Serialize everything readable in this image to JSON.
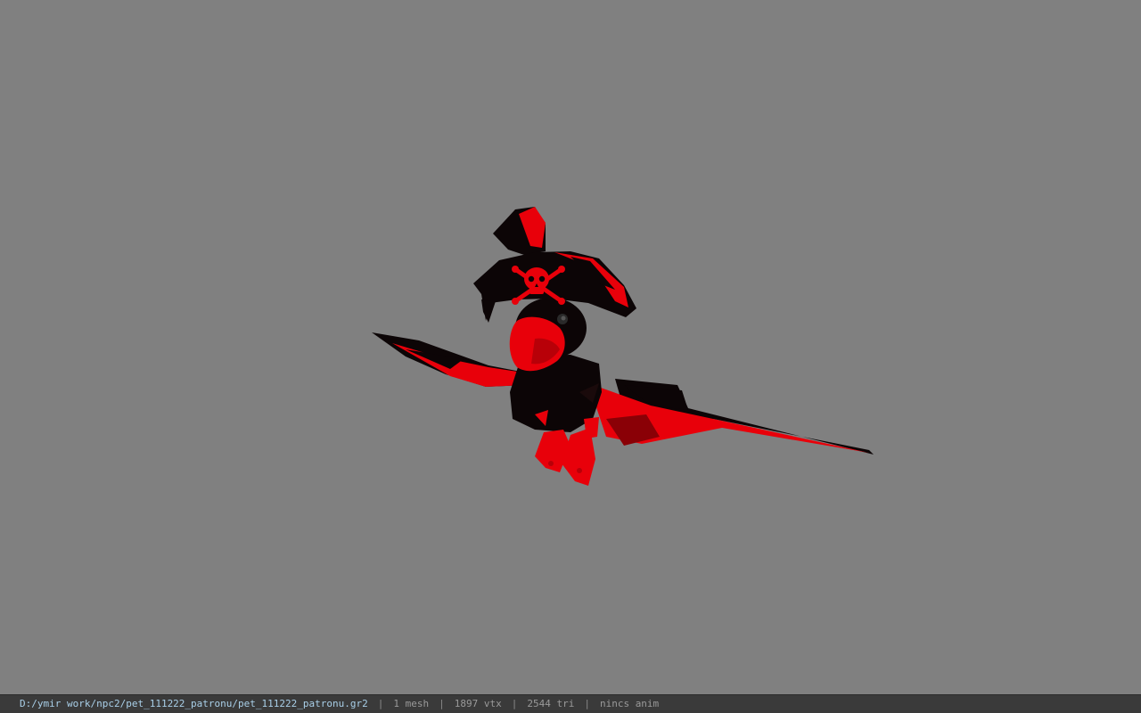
{
  "viewport": {
    "background_color": "#808080",
    "model": {
      "name": "pirate-parrot",
      "colors": {
        "red": "#e8000a",
        "black": "#0c0506",
        "dark_red": "#8a0006"
      }
    }
  },
  "statusbar": {
    "file_path": "D:/ymir work/npc2/pet_111222_patronu/pet_111222_patronu.gr2",
    "mesh_count": "1 mesh",
    "vertex_count": "1897 vtx",
    "triangle_count": "2544 tri",
    "animation": "nincs anim",
    "separator": "|"
  }
}
